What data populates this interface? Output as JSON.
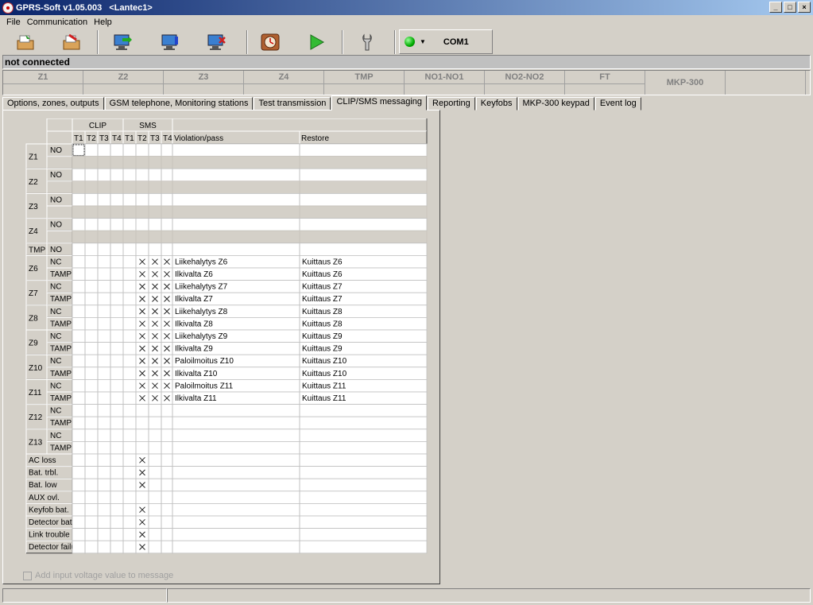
{
  "window": {
    "title": "GPRS-Soft v1.05.003   <Lantec1>",
    "btn_min": "_",
    "btn_max": "□",
    "btn_close": "×"
  },
  "menu": [
    "File",
    "Communication",
    "Help"
  ],
  "connection": {
    "port": "COM1",
    "led_color": "#00a000"
  },
  "status_text": "not connected",
  "zones": [
    "Z1",
    "Z2",
    "Z3",
    "Z4",
    "TMP",
    "NO1-NO1",
    "NO2-NO2",
    "FT",
    "MKP-300",
    ""
  ],
  "tabs": [
    "Options, zones, outputs",
    "GSM telephone, Monitoring stations",
    "Test transmission",
    "CLIP/SMS messaging",
    "Reporting",
    "Keyfobs",
    "MKP-300 keypad",
    "Event log"
  ],
  "active_tab": 3,
  "grid": {
    "group_clip": "CLIP",
    "group_sms": "SMS",
    "col_headers": [
      "T1",
      "T2",
      "T3",
      "T4",
      "T1",
      "T2",
      "T3",
      "T4",
      "Violation/pass",
      "Restore"
    ],
    "zone_groups": [
      {
        "zone": "Z1",
        "rows": [
          {
            "type": "NO",
            "marks": [],
            "violation": "",
            "restore": ""
          },
          {
            "type": "",
            "marks": [],
            "violation": "",
            "restore": "",
            "gray": true
          }
        ]
      },
      {
        "zone": "Z2",
        "rows": [
          {
            "type": "NO",
            "marks": [],
            "violation": "",
            "restore": ""
          },
          {
            "type": "",
            "marks": [],
            "violation": "",
            "restore": "",
            "gray": true
          }
        ]
      },
      {
        "zone": "Z3",
        "rows": [
          {
            "type": "NO",
            "marks": [],
            "violation": "",
            "restore": ""
          },
          {
            "type": "",
            "marks": [],
            "violation": "",
            "restore": "",
            "gray": true
          }
        ]
      },
      {
        "zone": "Z4",
        "rows": [
          {
            "type": "NO",
            "marks": [],
            "violation": "",
            "restore": ""
          },
          {
            "type": "",
            "marks": [],
            "violation": "",
            "restore": "",
            "gray": true
          }
        ]
      },
      {
        "zone": "TMP",
        "rows": [
          {
            "type": "NO",
            "marks": [],
            "violation": "",
            "restore": ""
          }
        ]
      },
      {
        "zone": "Z6",
        "rows": [
          {
            "type": "NC",
            "marks": [
              5,
              6,
              7
            ],
            "violation": "Liikehalytys Z6",
            "restore": "Kuittaus Z6"
          },
          {
            "type": "TAMP",
            "marks": [
              5,
              6,
              7
            ],
            "violation": "Ilkivalta Z6",
            "restore": "Kuittaus Z6"
          }
        ]
      },
      {
        "zone": "Z7",
        "rows": [
          {
            "type": "NC",
            "marks": [
              5,
              6,
              7
            ],
            "violation": "Liikehalytys Z7",
            "restore": "Kuittaus Z7"
          },
          {
            "type": "TAMP",
            "marks": [
              5,
              6,
              7
            ],
            "violation": "Ilkivalta Z7",
            "restore": "Kuittaus Z7"
          }
        ]
      },
      {
        "zone": "Z8",
        "rows": [
          {
            "type": "NC",
            "marks": [
              5,
              6,
              7
            ],
            "violation": "Liikehalytys Z8",
            "restore": "Kuittaus Z8"
          },
          {
            "type": "TAMP",
            "marks": [
              5,
              6,
              7
            ],
            "violation": "Ilkivalta Z8",
            "restore": "Kuittaus Z8"
          }
        ]
      },
      {
        "zone": "Z9",
        "rows": [
          {
            "type": "NC",
            "marks": [
              5,
              6,
              7
            ],
            "violation": "Liikehalytys Z9",
            "restore": "Kuittaus Z9"
          },
          {
            "type": "TAMP",
            "marks": [
              5,
              6,
              7
            ],
            "violation": "Ilkivalta Z9",
            "restore": "Kuittaus Z9"
          }
        ]
      },
      {
        "zone": "Z10",
        "rows": [
          {
            "type": "NC",
            "marks": [
              5,
              6,
              7
            ],
            "violation": "Paloilmoitus Z10",
            "restore": "Kuittaus Z10"
          },
          {
            "type": "TAMP",
            "marks": [
              5,
              6,
              7
            ],
            "violation": "Ilkivalta Z10",
            "restore": "Kuittaus Z10"
          }
        ]
      },
      {
        "zone": "Z11",
        "rows": [
          {
            "type": "NC",
            "marks": [
              5,
              6,
              7
            ],
            "violation": "Paloilmoitus Z11",
            "restore": "Kuittaus Z11"
          },
          {
            "type": "TAMP",
            "marks": [
              5,
              6,
              7
            ],
            "violation": "Ilkivalta Z11",
            "restore": "Kuittaus Z11"
          }
        ]
      },
      {
        "zone": "Z12",
        "rows": [
          {
            "type": "NC",
            "marks": [],
            "violation": "",
            "restore": ""
          },
          {
            "type": "TAMP",
            "marks": [],
            "violation": "",
            "restore": ""
          }
        ]
      },
      {
        "zone": "Z13",
        "rows": [
          {
            "type": "NC",
            "marks": [],
            "violation": "",
            "restore": ""
          },
          {
            "type": "TAMP",
            "marks": [],
            "violation": "",
            "restore": ""
          }
        ]
      }
    ],
    "system_rows": [
      {
        "label": "AC loss",
        "marks": [
          5
        ]
      },
      {
        "label": "Bat. trbl.",
        "marks": [
          5
        ]
      },
      {
        "label": "Bat. low",
        "marks": [
          5
        ]
      },
      {
        "label": "AUX ovl.",
        "marks": []
      },
      {
        "label": "Keyfob bat.",
        "marks": [
          5
        ]
      },
      {
        "label": "Detector bat. l",
        "marks": [
          5
        ]
      },
      {
        "label": "Link trouble",
        "marks": [
          5
        ]
      },
      {
        "label": "Detector  failu",
        "marks": [
          5
        ]
      }
    ]
  },
  "checkbox_label": "Add input voltage value to message"
}
